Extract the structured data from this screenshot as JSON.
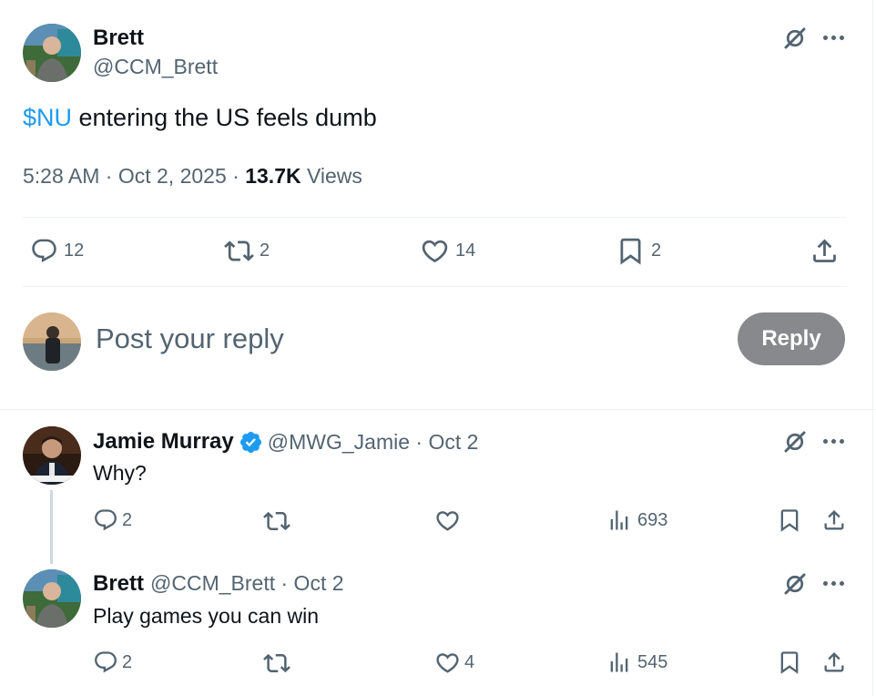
{
  "main_tweet": {
    "author_name": "Brett",
    "author_handle": "@CCM_Brett",
    "cashtag": "$NU",
    "text_rest": " entering the US feels dumb",
    "time": "5:28 AM",
    "sep1": " · ",
    "date": "Oct 2, 2025",
    "sep2": " · ",
    "views_count": "13.7K",
    "views_label": " Views",
    "replies": "12",
    "retweets": "2",
    "likes": "14",
    "bookmarks": "2"
  },
  "reply_box": {
    "placeholder": "Post your reply",
    "button_label": "Reply"
  },
  "replies": [
    {
      "author_name": "Jamie Murray",
      "author_handle": "@MWG_Jamie",
      "date": " · Oct 2",
      "text": "Why?",
      "replies": "2",
      "retweets": "",
      "likes": "",
      "views": "693",
      "verified": true
    },
    {
      "author_name": "Brett",
      "author_handle": "@CCM_Brett",
      "date": " · Oct 2",
      "text": "Play games you can win",
      "replies": "2",
      "retweets": "",
      "likes": "4",
      "views": "545",
      "verified": false
    }
  ],
  "colors": {
    "link_blue": "#1d9bf0",
    "muted": "#536471",
    "reply_button_bg": "#87898c"
  },
  "icons": [
    "grok-icon",
    "more-icon",
    "reply-icon",
    "retweet-icon",
    "like-icon",
    "bookmark-icon",
    "share-icon",
    "views-icon",
    "verified-icon"
  ]
}
